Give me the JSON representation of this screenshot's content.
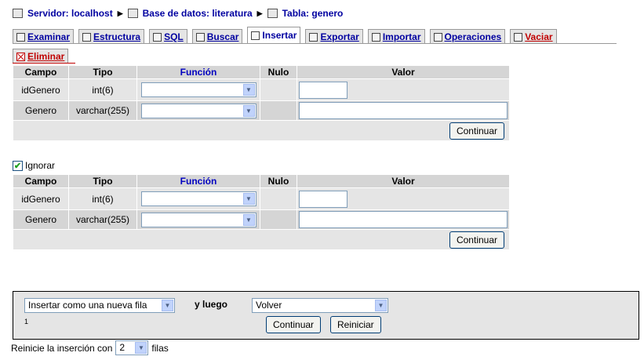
{
  "breadcrumb": {
    "server": "Servidor: localhost",
    "database": "Base de datos: literatura",
    "table": "Tabla: genero"
  },
  "tabs": [
    {
      "label": "Examinar",
      "icon": "browse-icon"
    },
    {
      "label": "Estructura",
      "icon": "structure-icon"
    },
    {
      "label": "SQL",
      "icon": "sql-icon"
    },
    {
      "label": "Buscar",
      "icon": "search-icon"
    },
    {
      "label": "Insertar",
      "icon": "insert-icon",
      "active": true
    },
    {
      "label": "Exportar",
      "icon": "export-icon"
    },
    {
      "label": "Importar",
      "icon": "import-icon"
    },
    {
      "label": "Operaciones",
      "icon": "operations-icon"
    },
    {
      "label": "Vaciar",
      "icon": "empty-icon"
    }
  ],
  "tab_eliminar": "Eliminar",
  "headers": {
    "campo": "Campo",
    "tipo": "Tipo",
    "funcion": "Función",
    "nulo": "Nulo",
    "valor": "Valor"
  },
  "form1": {
    "rows": [
      {
        "campo": "idGenero",
        "tipo": "int(6)",
        "funcion": "",
        "valor": ""
      },
      {
        "campo": "Genero",
        "tipo": "varchar(255)",
        "funcion": "",
        "valor": ""
      }
    ],
    "continue": "Continuar"
  },
  "ignore": {
    "label": "Ignorar",
    "checked": true
  },
  "form2": {
    "rows": [
      {
        "campo": "idGenero",
        "tipo": "int(6)",
        "funcion": "",
        "valor": ""
      },
      {
        "campo": "Genero",
        "tipo": "varchar(255)",
        "funcion": "",
        "valor": ""
      }
    ],
    "continue": "Continuar"
  },
  "bottom": {
    "insert_mode": "Insertar como una nueva fila",
    "and_then": "y luego",
    "after_action": "Volver",
    "footnote": "1",
    "continue": "Continuar",
    "reset": "Reiniciar"
  },
  "restart": {
    "prefix": "Reinicie la inserción con",
    "count": "2",
    "suffix": "filas"
  }
}
